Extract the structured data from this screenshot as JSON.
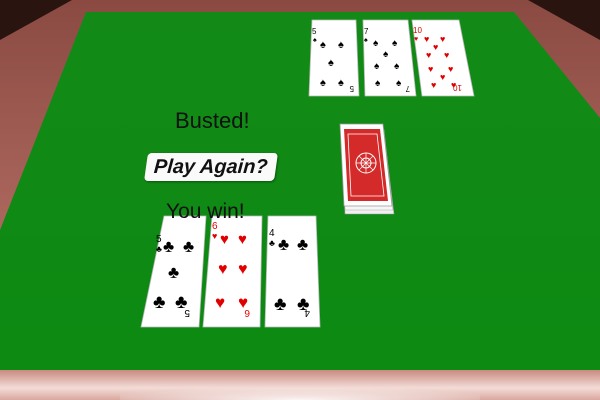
{
  "status": {
    "dealer_result": "Busted!",
    "player_result": "You win!"
  },
  "buttons": {
    "play_again": "Play Again?"
  },
  "colors": {
    "felt": "#0f8a14",
    "rail": "#b06a5e",
    "card_back": "#d42a2a",
    "suit_red": "#e00000",
    "suit_black": "#000000"
  },
  "dealer_hand": [
    {
      "rank": "5",
      "suit": "spades"
    },
    {
      "rank": "7",
      "suit": "spades"
    },
    {
      "rank": "10",
      "suit": "hearts"
    }
  ],
  "player_hand": [
    {
      "rank": "5",
      "suit": "clubs"
    },
    {
      "rank": "6",
      "suit": "hearts"
    },
    {
      "rank": "4",
      "suit": "clubs"
    }
  ],
  "deck": {
    "face": "down"
  }
}
